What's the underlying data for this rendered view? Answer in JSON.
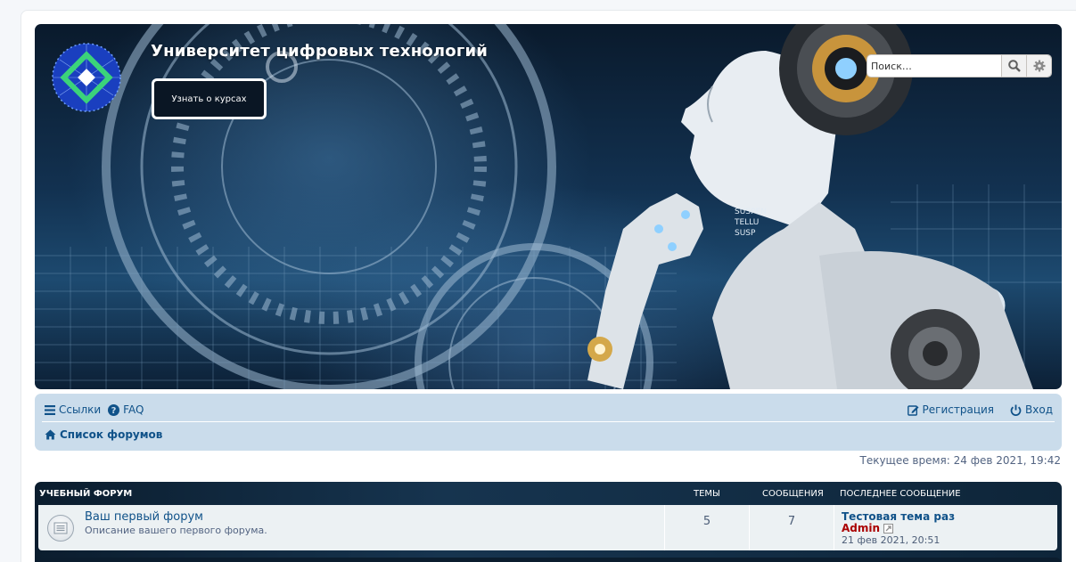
{
  "header": {
    "site_title": "Университет цифровых технологий",
    "course_button": "Узнать о курсах",
    "search_placeholder": "Поиск…"
  },
  "navbar": {
    "links_label": "Ссылки",
    "faq_label": "FAQ",
    "register_label": "Регистрация",
    "login_label": "Вход",
    "breadcrumb": "Список форумов"
  },
  "current_time": "Текущее время: 24 фев 2021, 19:42",
  "forum": {
    "category": "УЧЕБНЫЙ ФОРУМ",
    "col_topics": "ТЕМЫ",
    "col_posts": "СООБЩЕНИЯ",
    "col_last": "ПОСЛЕДНЕЕ СООБЩЕНИЕ",
    "rows": [
      {
        "title": "Ваш первый форум",
        "description": "Описание вашего первого форума.",
        "topics": "5",
        "posts": "7",
        "last_title": "Тестовая тема раз",
        "last_author": "Admin",
        "last_date": "21 фев 2021, 20:51"
      }
    ]
  },
  "colors": {
    "link": "#105289",
    "author": "#aa0000",
    "navbar_bg": "#cadceb",
    "row_bg": "#ecf1f3"
  },
  "icons": [
    "logo-icon",
    "search-icon",
    "gear-icon",
    "bars-icon",
    "question-icon",
    "edit-icon",
    "power-icon",
    "home-icon",
    "forum-read-icon",
    "view-post-icon"
  ]
}
